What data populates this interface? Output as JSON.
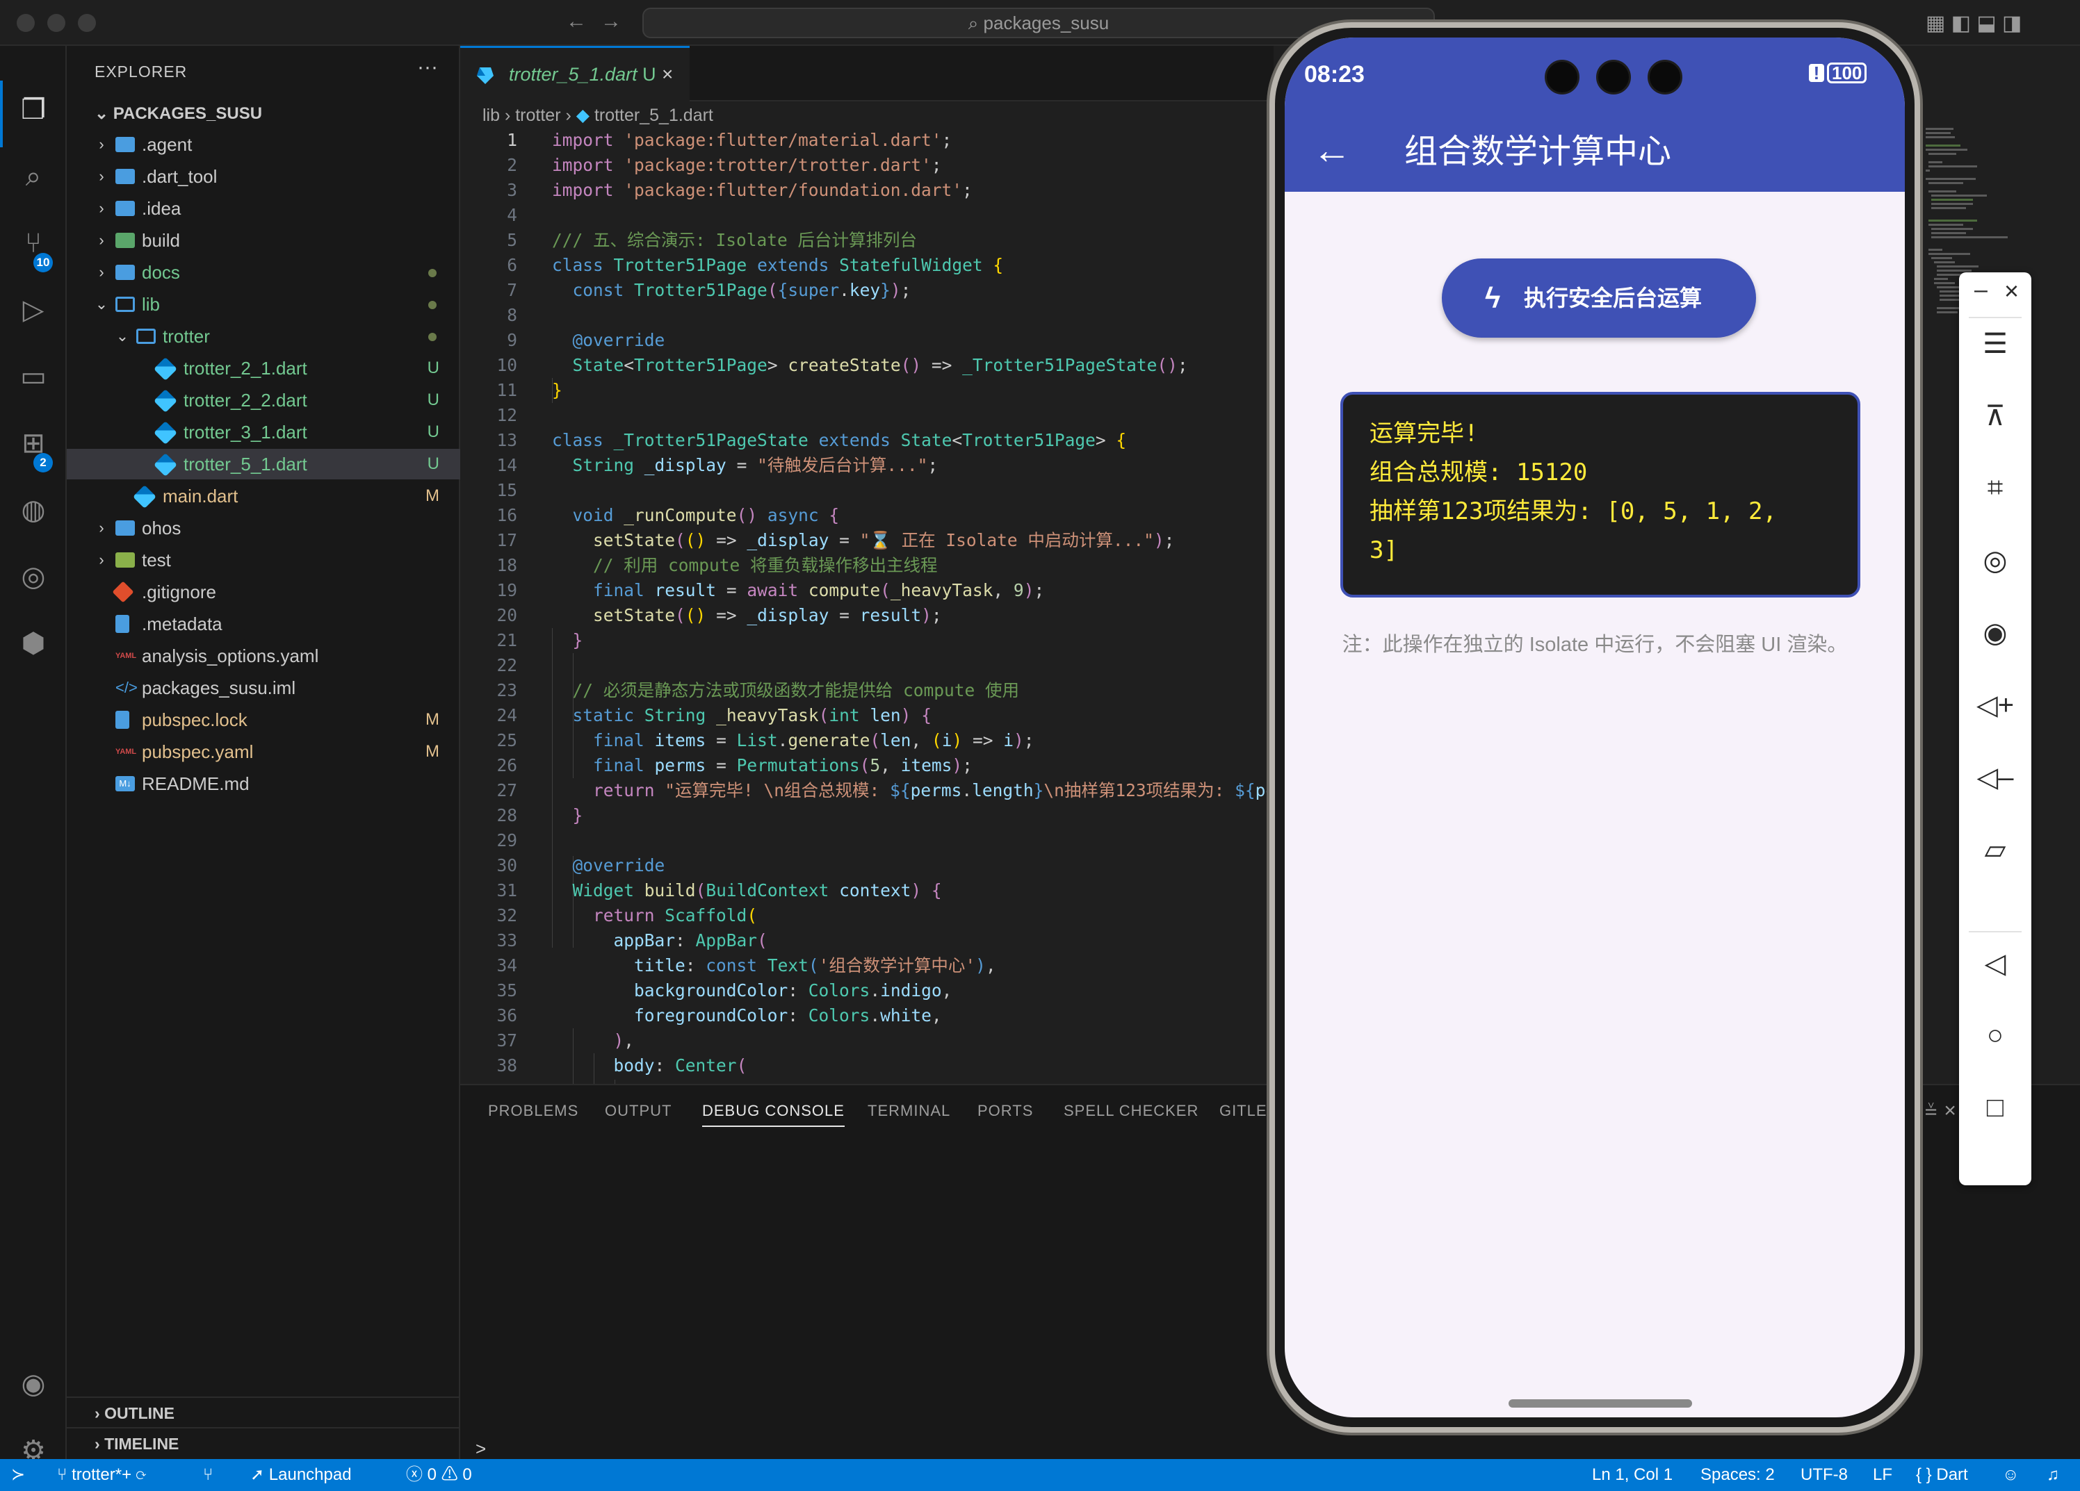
{
  "window": {
    "search": "packages_susu"
  },
  "activity": {
    "scm_badge": "10",
    "extensions_badge": "2"
  },
  "sidebar": {
    "header": "EXPLORER",
    "more": "···",
    "root": "PACKAGES_SUSU",
    "items": [
      {
        "label": ".agent",
        "status": ""
      },
      {
        "label": ".dart_tool",
        "status": ""
      },
      {
        "label": ".idea",
        "status": ""
      },
      {
        "label": "build",
        "status": ""
      },
      {
        "label": "docs",
        "status": ""
      },
      {
        "label": "lib",
        "status": ""
      },
      {
        "label": "trotter",
        "status": ""
      },
      {
        "label": "trotter_2_1.dart",
        "status": "U"
      },
      {
        "label": "trotter_2_2.dart",
        "status": "U"
      },
      {
        "label": "trotter_3_1.dart",
        "status": "U"
      },
      {
        "label": "trotter_5_1.dart",
        "status": "U"
      },
      {
        "label": "main.dart",
        "status": "M"
      },
      {
        "label": "ohos",
        "status": ""
      },
      {
        "label": "test",
        "status": ""
      },
      {
        "label": ".gitignore",
        "status": ""
      },
      {
        "label": ".metadata",
        "status": ""
      },
      {
        "label": "analysis_options.yaml",
        "status": ""
      },
      {
        "label": "packages_susu.iml",
        "status": ""
      },
      {
        "label": "pubspec.lock",
        "status": "M"
      },
      {
        "label": "pubspec.yaml",
        "status": "M"
      },
      {
        "label": "README.md",
        "status": ""
      }
    ],
    "outline": "OUTLINE",
    "timeline": "TIMELINE"
  },
  "editor": {
    "tab_label": "trotter_5_1.dart",
    "tab_status": "U",
    "breadcrumb": [
      "lib",
      "trotter",
      "trotter_5_1.dart"
    ]
  },
  "panel": {
    "tabs": [
      "PROBLEMS",
      "OUTPUT",
      "DEBUG CONSOLE",
      "TERMINAL",
      "PORTS",
      "SPELL CHECKER",
      "GITLENS"
    ],
    "active_tab": "DEBUG CONSOLE",
    "prompt": ">"
  },
  "phone": {
    "time": "08:23",
    "battery": "100",
    "title": "组合数学计算中心",
    "button_label": "执行安全后台运算",
    "result_text": "运算完毕!\n组合总规模: 15120\n抽样第123项结果为: [0, 5, 1, 2,\n3]",
    "note": "注：此操作在独立的 Isolate 中运行，不会阻塞 UI 渲染。"
  },
  "status_bar": {
    "branch": "trotter*+",
    "launchpad": "Launchpad",
    "errors": "0",
    "warnings": "0",
    "position": "Ln 1, Col 1",
    "spaces": "Spaces: 2",
    "encoding": "UTF-8",
    "eol": "LF",
    "language": "Dart"
  },
  "colors": {
    "accent": "#0078d4",
    "indigo": "#3f51b5",
    "result_text": "#ffeb3b"
  }
}
